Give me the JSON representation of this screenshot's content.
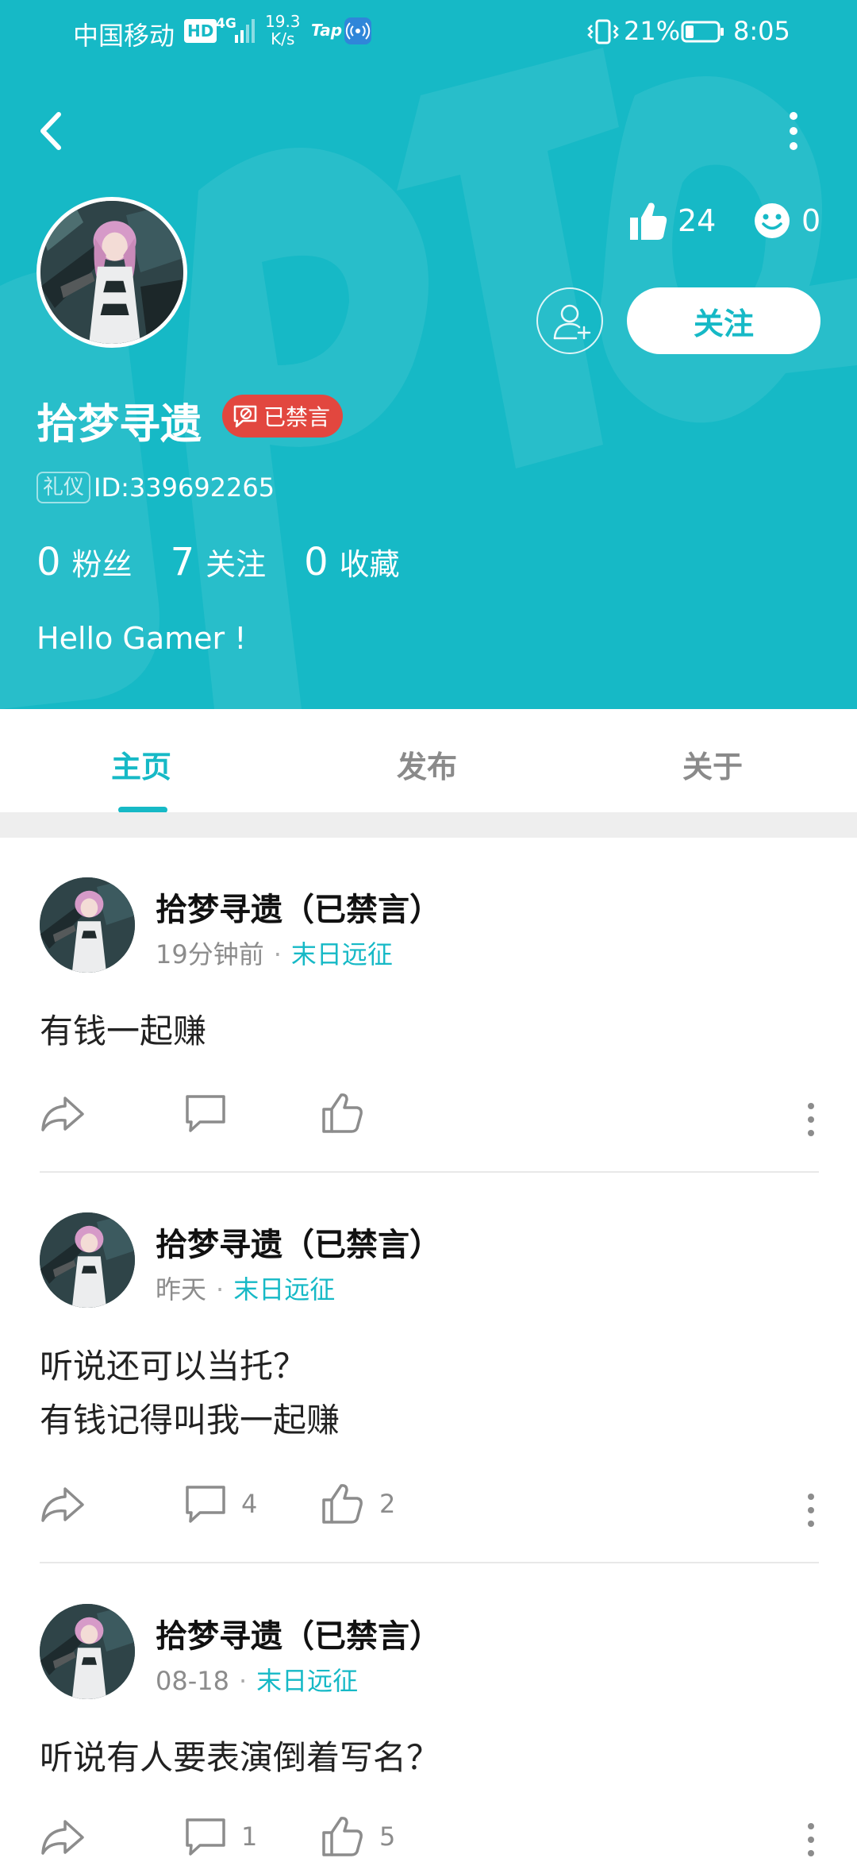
{
  "status_bar": {
    "carrier": "中国移动",
    "hd": "HD",
    "network": "4G",
    "speed_value": "19.3",
    "speed_unit": "K/s",
    "tap": "Tap",
    "battery": "21%",
    "time": "8:05"
  },
  "profile": {
    "likes": "24",
    "faces": "0",
    "follow_label": "关注",
    "name": "拾梦寻遗",
    "muted_badge": "已禁言",
    "id_tag": "礼仪",
    "id_text": "ID:339692265",
    "stats": [
      {
        "value": "0",
        "label": "粉丝"
      },
      {
        "value": "7",
        "label": "关注"
      },
      {
        "value": "0",
        "label": "收藏"
      }
    ],
    "bio": "Hello Gamer !"
  },
  "tabs": [
    {
      "label": "主页",
      "active": true
    },
    {
      "label": "发布",
      "active": false
    },
    {
      "label": "关于",
      "active": false
    }
  ],
  "posts": [
    {
      "author": "拾梦寻遗（已禁言）",
      "time": "19分钟前",
      "separator": "·",
      "game": "末日远征",
      "lines": [
        "有钱一起赚"
      ],
      "comments": "",
      "likes": ""
    },
    {
      "author": "拾梦寻遗（已禁言）",
      "time": "昨天",
      "separator": "·",
      "game": "末日远征",
      "lines": [
        "听说还可以当托？",
        "有钱记得叫我一起赚"
      ],
      "comments": "4",
      "likes": "2"
    },
    {
      "author": "拾梦寻遗（已禁言）",
      "time": "08-18",
      "separator": "·",
      "game": "末日远征",
      "lines": [
        "听说有人要表演倒着写名？"
      ],
      "comments": "1",
      "likes": "5"
    }
  ],
  "colors": {
    "brand": "#16b9c6",
    "muted_red": "#e2473f"
  },
  "icons": {
    "back": "chevron-left-icon",
    "more": "more-vertical-icon",
    "like": "thumbs-up-icon",
    "face": "smiley-icon",
    "add_friend": "add-user-icon",
    "share": "share-icon",
    "comment": "comment-icon"
  }
}
